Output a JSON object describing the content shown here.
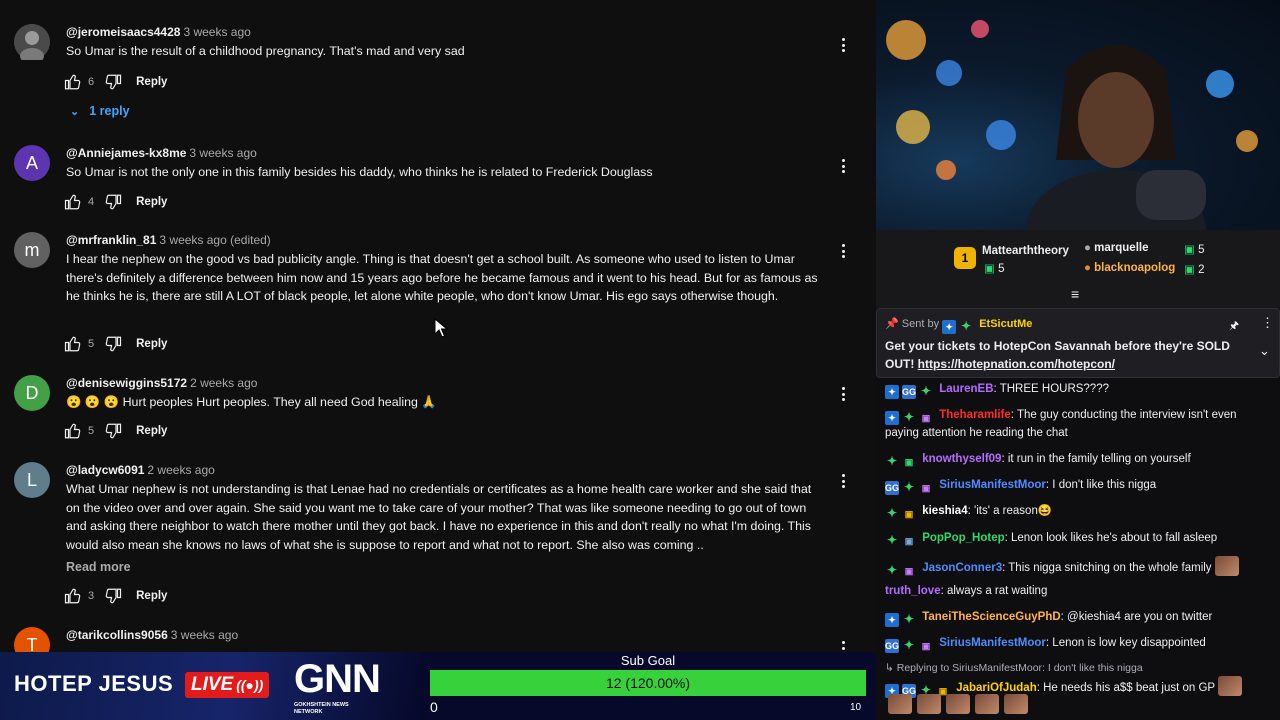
{
  "comments": [
    {
      "user": "@jeromeisaacs4428",
      "time": "3 weeks ago",
      "text": "So Umar is the result of a childhood pregnancy. That's mad and very sad",
      "likes": "6",
      "reply_label": "Reply",
      "replies_label": "1 reply"
    },
    {
      "user": "@Anniejames-kx8me",
      "time": "3 weeks ago",
      "avatar_letter": "A",
      "text": "So Umar is not the only one in this family besides his daddy, who thinks he is related to Frederick Douglass",
      "likes": "4",
      "reply_label": "Reply"
    },
    {
      "user": "@mrfranklin_81",
      "time": "3 weeks ago (edited)",
      "avatar_letter": "m",
      "text": "I hear the nephew on the good vs bad publicity angle. Thing is that doesn't get a school built. As someone who used to listen to Umar there's definitely a difference between him now and 15 years ago before he became famous and it went to his head. But for as famous as he thinks he is, there are still A LOT of black people, let alone white people, who don't know Umar. His ego says otherwise though.",
      "likes": "5",
      "reply_label": "Reply"
    },
    {
      "user": "@denisewiggins5172",
      "time": "2 weeks ago",
      "avatar_letter": "D",
      "text": "😮 😮 😮  Hurt peoples Hurt peoples. They all need God healing 🙏",
      "likes": "5",
      "reply_label": "Reply"
    },
    {
      "user": "@ladycw6091",
      "time": "2 weeks ago",
      "avatar_letter": "L",
      "text": "What Umar nephew is not understanding is that Lenae had no credentials or certificates as a home health care worker and she said that on the video over and over again. She said you want me to take care of your mother? That was like someone needing to go out of town and asking there neighbor to watch there mother until they got back. I have no experience in this and don't really no what I'm doing. This would also mean she knows no laws of what she is suppose to report and what not to report.  She also was coming ..",
      "read_more": "Read more",
      "likes": "3",
      "reply_label": "Reply"
    },
    {
      "user": "@tarikcollins9056",
      "time": "3 weeks ago",
      "avatar_letter": "T"
    }
  ],
  "supporters": {
    "first": {
      "rank": "1",
      "name": "Mattearththeory",
      "count": "5"
    },
    "others": [
      {
        "name": "marquelle",
        "count": "5"
      },
      {
        "name": "blacknoapolog",
        "count": "2"
      }
    ]
  },
  "pinned": {
    "sent_by_label": "Sent by",
    "sender": "EtSicutMe",
    "message": "Get your tickets to HotepCon Savannah before they're SOLD OUT!",
    "link": "https://hotepnation.com/hotepcon/"
  },
  "chat": [
    {
      "user": "LaurenEB",
      "color": "#b46bff",
      "text": ": THREE HOURS????"
    },
    {
      "user": "Theharamlife",
      "color": "#ff2a2a",
      "text": ": The guy conducting the interview isn't even paying attention he reading the chat"
    },
    {
      "user": "knowthyself09",
      "color": "#b46bff",
      "text": ": it run in the family telling on yourself"
    },
    {
      "user": "SiriusManifestMoor",
      "color": "#4d8dff",
      "text": ": I don't like this nigga"
    },
    {
      "user": "kieshia4",
      "color": "#ffffff",
      "text": ": 'its' a reason😆"
    },
    {
      "user": "PopPop_Hotep",
      "color": "#2bd96f",
      "text": ": Lenon look likes he's about to fall asleep"
    },
    {
      "user": "JasonConner3",
      "color": "#4d8dff",
      "text": ": This nigga snitching on the whole family"
    },
    {
      "user": "truth_love",
      "color": "#b46bff",
      "text": ": always a rat waiting"
    },
    {
      "user": "TaneiTheScienceGuyPhD",
      "color": "#ffb347",
      "text": ": @kieshia4 are you on twitter"
    },
    {
      "user": "SiriusManifestMoor",
      "color": "#4d8dff",
      "text": ": Lenon is low key disappointed"
    },
    {
      "reply_context": "Replying to SiriusManifestMoor: I don't like this nigga"
    },
    {
      "user": "JabariOfJudah",
      "color": "#ffd400",
      "text": ": He needs his a$$ beat just on GP"
    }
  ],
  "overlay": {
    "brand_left": "HOTEP JESUS",
    "live_label": "LIVE",
    "gnn_title": "GNN",
    "gnn_sub": "GOKHSHTEIN NEWS NETWORK",
    "goal_title": "Sub Goal",
    "goal_value": "12 (120.00%)",
    "goal_min": "0",
    "goal_max": "10",
    "goal_progress": 1.0
  },
  "colors": {
    "reply_link": "#3ea6ff",
    "goal_fill": "#37d13c",
    "avatar_a": "#5e35b1",
    "avatar_m": "#616161",
    "avatar_d": "#43a047",
    "avatar_l": "#607d8b",
    "avatar_t": "#e65100"
  },
  "icons": [
    "thumb-up-icon",
    "thumb-down-icon",
    "kebab-menu-icon",
    "chevron-down-icon",
    "pin-icon",
    "prime-badge-icon",
    "verified-leaf-icon",
    "mouse-cursor-icon"
  ]
}
